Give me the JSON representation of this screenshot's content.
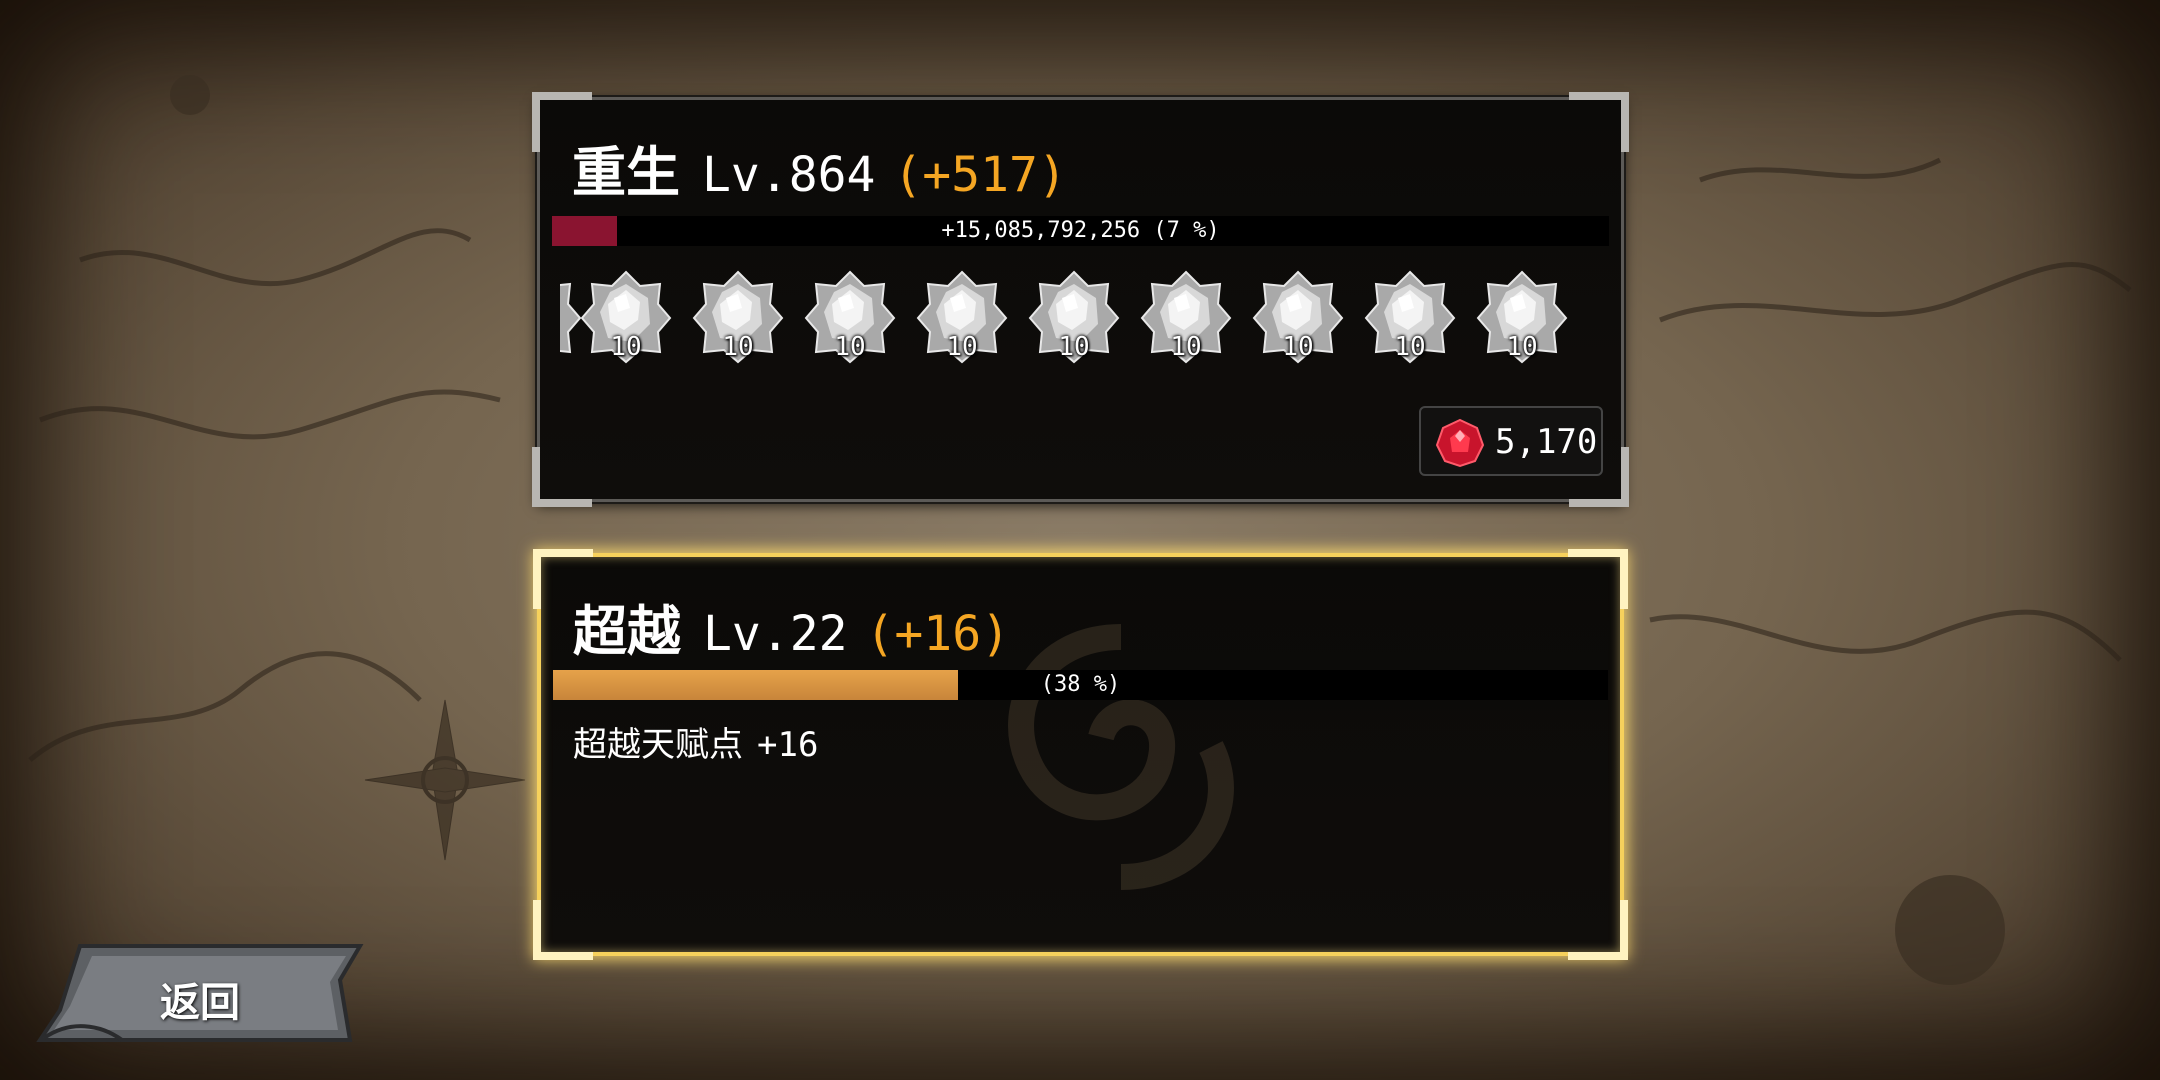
{
  "rebirth": {
    "name": "重生",
    "level": "Lv.864",
    "bonus": "(+517)",
    "progress_text": "+15,085,792,256 (7 %)",
    "progress_fraction": 0.07,
    "gems": [
      {
        "icon": "white-crystal-icon",
        "count": "10"
      },
      {
        "icon": "white-crystal-icon",
        "count": "10"
      },
      {
        "icon": "white-crystal-icon",
        "count": "10"
      },
      {
        "icon": "white-crystal-icon",
        "count": "10"
      },
      {
        "icon": "white-crystal-icon",
        "count": "10"
      },
      {
        "icon": "white-crystal-icon",
        "count": "10"
      },
      {
        "icon": "white-crystal-icon",
        "count": "10"
      },
      {
        "icon": "white-crystal-icon",
        "count": "10"
      },
      {
        "icon": "white-crystal-icon",
        "count": "10"
      }
    ],
    "currency": {
      "icon": "red-gem-icon",
      "value": "5,170"
    }
  },
  "transcend": {
    "name": "超越",
    "level": "Lv.22",
    "bonus": "(+16)",
    "progress_text": "(38 %)",
    "progress_fraction": 0.38,
    "talent_label": "超越天赋点",
    "talent_value": "+16"
  },
  "back_button": {
    "label": "返回"
  },
  "colors": {
    "accent_orange": "#f5a623",
    "rebirth_bar": "#8a1430",
    "transcend_bar": "#d8953f",
    "selected_glow": "#f6d15c"
  }
}
